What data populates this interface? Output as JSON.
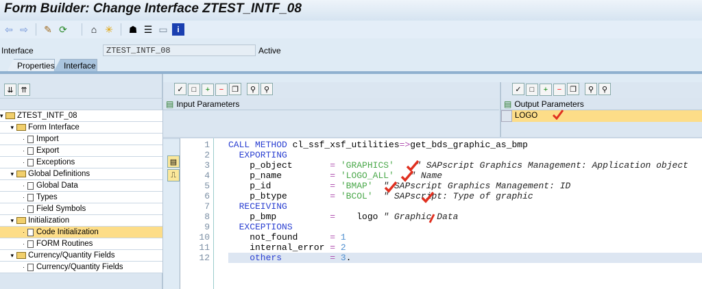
{
  "title": "Form Builder: Change Interface ZTEST_INTF_08",
  "toolbar": [
    "back-icon",
    "forward-icon",
    "display-change-icon",
    "activate-icon",
    "hierarchy-icon",
    "magic-wand-icon",
    "tree-icon",
    "layout-icon",
    "panel-icon",
    "info-icon"
  ],
  "interface": {
    "label": "Interface",
    "value": "ZTEST_INTF_08",
    "status": "Active"
  },
  "tabs": [
    {
      "label": "Properties"
    },
    {
      "label": "Interface"
    }
  ],
  "tree": [
    {
      "label": "ZTEST_INTF_08",
      "level": 0,
      "type": "folder"
    },
    {
      "label": "Form Interface",
      "level": 1,
      "type": "folder"
    },
    {
      "label": "Import",
      "level": 2,
      "type": "doc"
    },
    {
      "label": "Export",
      "level": 2,
      "type": "doc"
    },
    {
      "label": "Exceptions",
      "level": 2,
      "type": "doc"
    },
    {
      "label": "Global Definitions",
      "level": 1,
      "type": "folder"
    },
    {
      "label": "Global Data",
      "level": 2,
      "type": "doc"
    },
    {
      "label": "Types",
      "level": 2,
      "type": "doc"
    },
    {
      "label": "Field Symbols",
      "level": 2,
      "type": "doc"
    },
    {
      "label": "Initialization",
      "level": 1,
      "type": "folder"
    },
    {
      "label": "Code Initialization",
      "level": 2,
      "type": "doc",
      "selected": true
    },
    {
      "label": "FORM Routines",
      "level": 2,
      "type": "doc"
    },
    {
      "label": "Currency/Quantity Fields",
      "level": 1,
      "type": "folder"
    },
    {
      "label": "Currency/Quantity Fields",
      "level": 2,
      "type": "doc"
    }
  ],
  "input_params": {
    "header": "Input Parameters"
  },
  "output_params": {
    "header": "Output Parameters",
    "rows": [
      "LOGO"
    ]
  },
  "code": [
    [
      {
        "t": "CALL METHOD ",
        "c": "kw"
      },
      {
        "t": "cl_ssf_xsf_utilities"
      },
      {
        "t": "=>",
        "c": "op"
      },
      {
        "t": "get_bds_graphic_as_bmp"
      }
    ],
    [
      {
        "t": "  EXPORTING",
        "c": "kw"
      }
    ],
    [
      {
        "t": "    p_object       "
      },
      {
        "t": "= ",
        "c": "op"
      },
      {
        "t": "'GRAPHICS'",
        "c": "str"
      },
      {
        "t": "    \" SAPscript Graphics Management: Application object",
        "c": "cm"
      }
    ],
    [
      {
        "t": "    p_name         "
      },
      {
        "t": "= ",
        "c": "op"
      },
      {
        "t": "'LOGO_ALL'",
        "c": "str"
      },
      {
        "t": "   \" Name",
        "c": "cm"
      }
    ],
    [
      {
        "t": "    p_id           "
      },
      {
        "t": "= ",
        "c": "op"
      },
      {
        "t": "'BMAP'",
        "c": "str"
      },
      {
        "t": "  \" SAPscript Graphics Management: ID",
        "c": "cm"
      }
    ],
    [
      {
        "t": "    p_btype        "
      },
      {
        "t": "= ",
        "c": "op"
      },
      {
        "t": "'BCOL'",
        "c": "str"
      },
      {
        "t": "  \" SAPscript: Type of graphic",
        "c": "cm"
      }
    ],
    [
      {
        "t": "  RECEIVING",
        "c": "kw"
      }
    ],
    [
      {
        "t": "    p_bmp          "
      },
      {
        "t": "=",
        "c": "op"
      },
      {
        "t": "    logo "
      },
      {
        "t": "\" Graphic Data",
        "c": "cm"
      }
    ],
    [
      {
        "t": "  EXCEPTIONS",
        "c": "kw"
      }
    ],
    [
      {
        "t": "    not_found      "
      },
      {
        "t": "= ",
        "c": "op"
      },
      {
        "t": "1",
        "c": "num"
      }
    ],
    [
      {
        "t": "    internal_error "
      },
      {
        "t": "= ",
        "c": "op"
      },
      {
        "t": "2",
        "c": "num"
      }
    ],
    [
      {
        "t": "    others",
        "c": "kw"
      },
      {
        "t": "         "
      },
      {
        "t": "= ",
        "c": "op"
      },
      {
        "t": "3",
        "c": "num"
      },
      {
        "t": "."
      }
    ]
  ],
  "highlight_line": 12
}
